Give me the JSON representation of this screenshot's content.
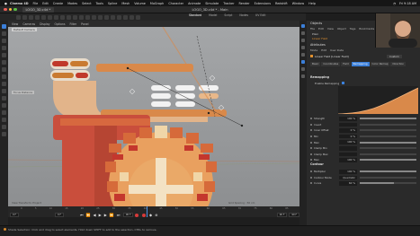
{
  "menubar": {
    "apple": "",
    "app": "Cinema 4D",
    "items": [
      "File",
      "Edit",
      "Create",
      "Modes",
      "Select",
      "Tools",
      "Spline",
      "Mesh",
      "Volume",
      "MoGraph",
      "Character",
      "Animate",
      "Simulate",
      "Tracker",
      "Render",
      "Extensions",
      "Redshift",
      "Window",
      "Help"
    ],
    "time": "Fri 9:18 AM"
  },
  "titlebar": {
    "doc": "LOGO_3D.c4d *",
    "title": "LOGO_3D.c4d * - Main",
    "layouts": [
      "Standard",
      "Model",
      "Script",
      "Nodes",
      "UV Edit",
      "BP - UV Edit"
    ]
  },
  "viewport": {
    "menu": [
      "View",
      "Cameras",
      "Display",
      "Options",
      "Filter",
      "Panel"
    ],
    "camera": "Default Camera",
    "focus": "Focus Distance",
    "info": "View Transform: Project",
    "grid": "Grid Spacing : 50 cm"
  },
  "timeline": {
    "ticks": [
      "0",
      "5",
      "10",
      "15",
      "20",
      "25",
      "30",
      "35",
      "40",
      "45",
      "50",
      "55",
      "60",
      "65",
      "70",
      "75",
      "80",
      "85",
      "90"
    ],
    "start": "0 F",
    "current": "0 F",
    "end": "90 F",
    "end2": "90 F",
    "frame": "90 F"
  },
  "statusbar": {
    "text": "Shade Selection: Click and drag to select elements. Hold down SHIFT to add to the selection, CTRL to remove."
  },
  "objects": {
    "title": "Objects",
    "tabs": [
      "File",
      "Edit",
      "View",
      "Object",
      "Tags",
      "Bookmarks"
    ],
    "rows": [
      "Plain",
      "Linear Field"
    ]
  },
  "attributes": {
    "title": "Attributes",
    "modes": [
      "Mode",
      "Edit",
      "User Data"
    ],
    "object_name": "Linear Field [Linear Field]",
    "custom": "Custom",
    "tabs": [
      "Basic",
      "Coordinates",
      "Field",
      "Remapping",
      "Color Remap",
      "Direction"
    ],
    "active_tab": "Remapping"
  },
  "remapping": {
    "header": "Remapping",
    "enable_label": "Enable Remapping",
    "params": [
      {
        "label": "Strength",
        "value": "100 %",
        "level": 1.0
      },
      {
        "label": "Invert",
        "value": "",
        "level": 0
      },
      {
        "label": "Inner Offset",
        "value": "0 %",
        "level": 0
      },
      {
        "label": "Min",
        "value": "0 %",
        "level": 0
      },
      {
        "label": "Max",
        "value": "100 %",
        "level": 1.0
      },
      {
        "label": "Clamp Min",
        "value": "",
        "level": 0
      },
      {
        "label": "Clamp Max",
        "value": "",
        "level": 0
      },
      {
        "label": "Max",
        "value": "100 %",
        "level": 1.0
      }
    ]
  },
  "contour": {
    "header": "Contour",
    "params": [
      {
        "label": "Multiplier",
        "value": "100 %",
        "level": 1.0
      },
      {
        "label": "Contour Mode",
        "value": "Quadratic",
        "level": 0
      },
      {
        "label": "Curve",
        "value": "60 %",
        "level": 0.6
      }
    ]
  },
  "colors": {
    "accent": "#3b7fd9",
    "selection": "#e0902f",
    "record": "#d63a3a"
  }
}
